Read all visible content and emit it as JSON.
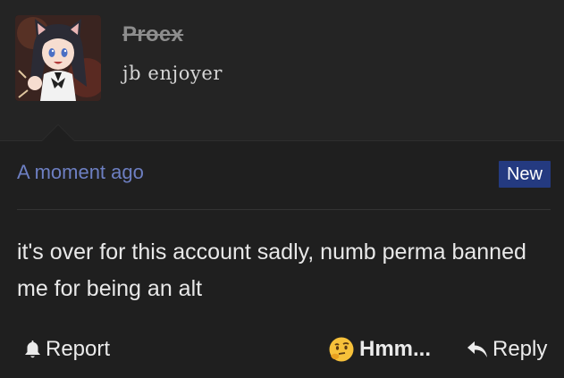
{
  "post": {
    "username": "Proex",
    "user_title": "jb enjoyer",
    "timestamp": "A moment ago",
    "badge": "New",
    "message": "it's over for this account sadly, numb perma banned me for being an alt"
  },
  "actions": {
    "report_label": "Report",
    "react_label": "Hmm...",
    "reply_label": "Reply"
  },
  "icons": {
    "report": "bell-icon",
    "react": "thinking-face-icon",
    "reply": "reply-arrow-icon"
  },
  "colors": {
    "background": "#1f1f1f",
    "header_background": "#242424",
    "timestamp": "#6d7fc2",
    "badge_background": "#243a80",
    "username_struck": "#8d8d8d",
    "text": "#e8e8e8"
  }
}
